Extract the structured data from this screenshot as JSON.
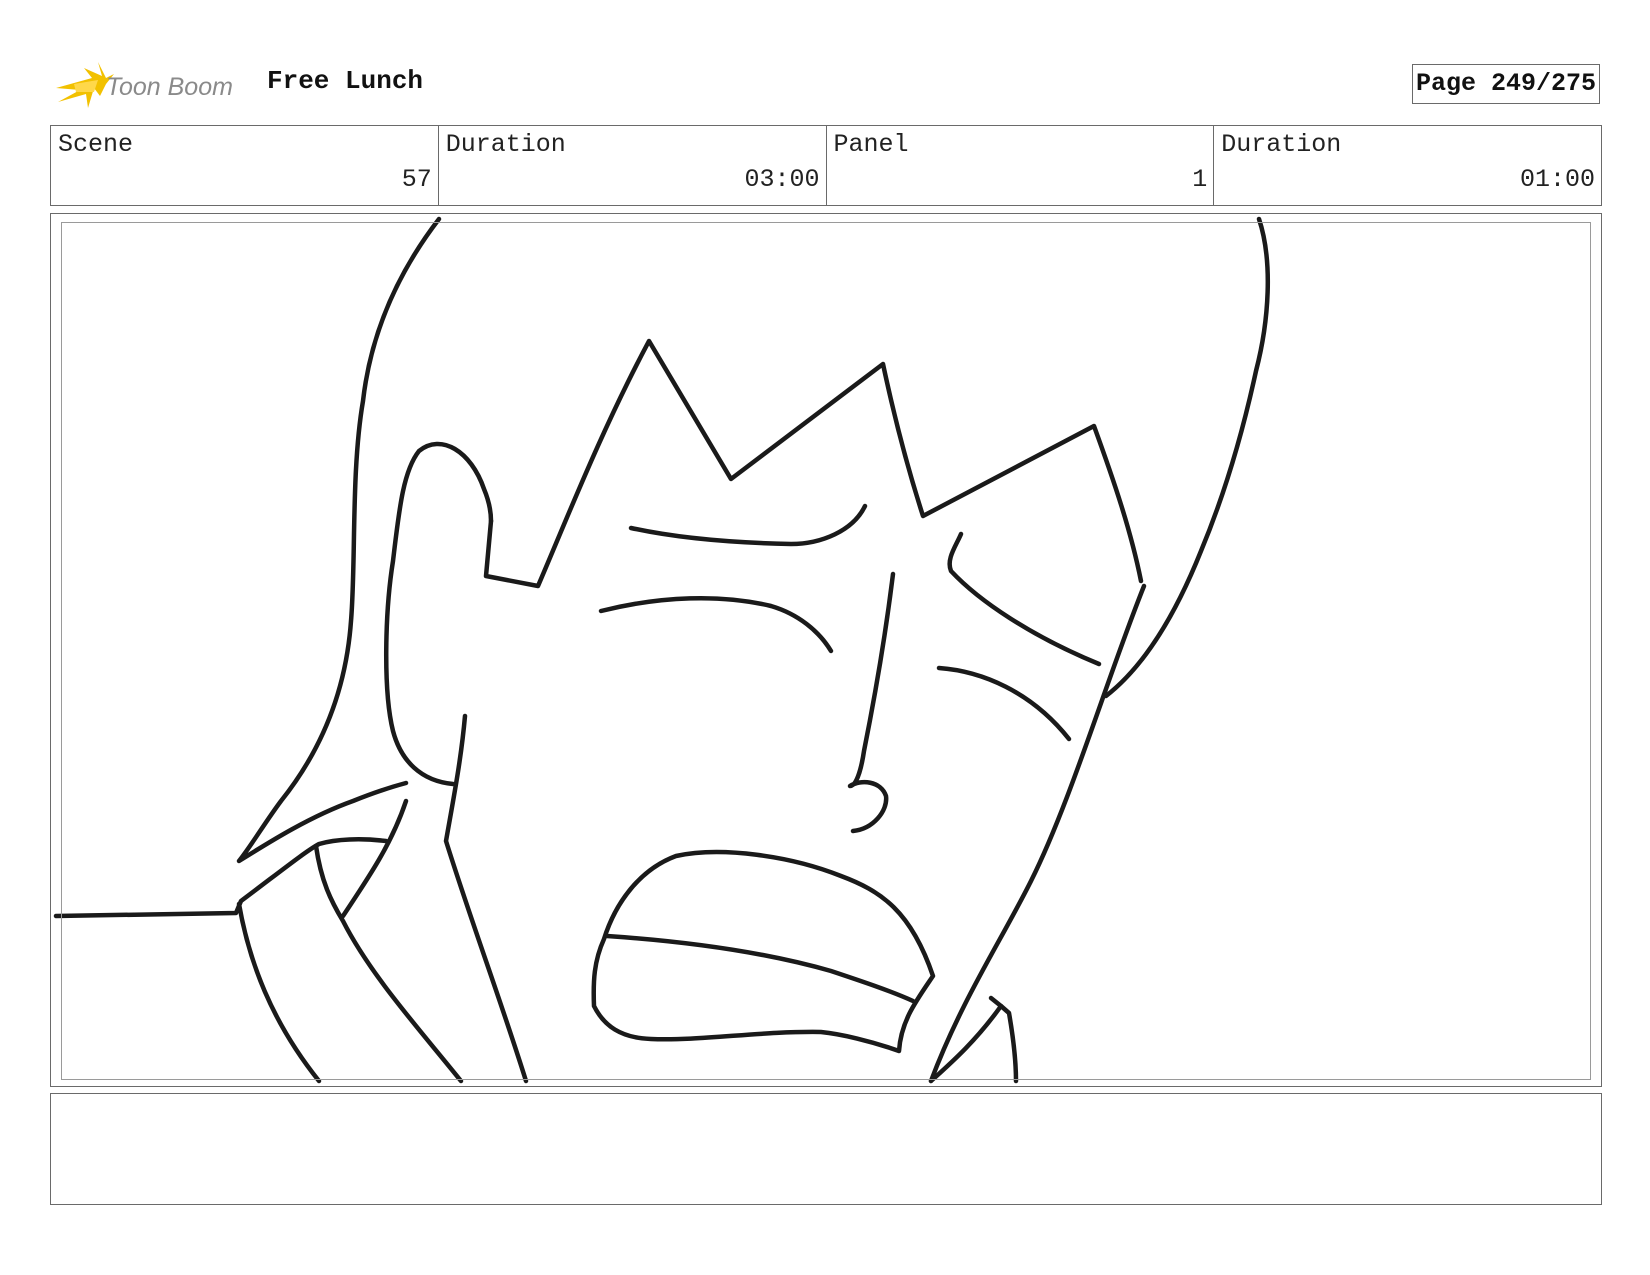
{
  "header": {
    "logo": {
      "brand_name": "Toon Boom",
      "icon": "toon-boom-star-icon",
      "star_color": "#f2c100",
      "text_color": "#8a8a8a"
    },
    "project_title": "Free Lunch",
    "page_indicator": "Page 249/275"
  },
  "info": {
    "scene": {
      "label": "Scene",
      "value": "57"
    },
    "scene_duration": {
      "label": "Duration",
      "value": "03:00"
    },
    "panel": {
      "label": "Panel",
      "value": "1"
    },
    "panel_duration": {
      "label": "Duration",
      "value": "01:00"
    }
  },
  "panel": {
    "content": "line-drawing of crying character close-up"
  },
  "caption": {
    "text": ""
  },
  "colors": {
    "line": "#1a1a1a",
    "frame_border": "#6a6a6a",
    "safe_frame_border": "#9a9a9a"
  }
}
